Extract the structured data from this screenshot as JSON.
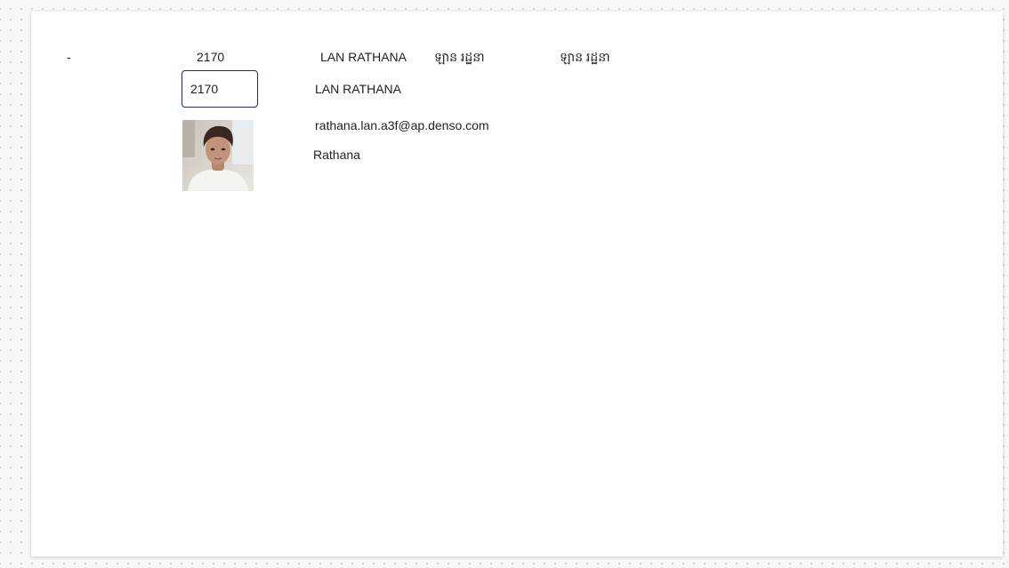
{
  "header_row": {
    "dash": "-",
    "employee_id": "2170",
    "full_name": "LAN RATHANA",
    "khmer_name_1": "ឡាន រដ្ឋនា",
    "khmer_name_2": "ឡាន រដ្ឋនា"
  },
  "form": {
    "employee_id_value": "2170",
    "full_name": "LAN RATHANA",
    "email": "rathana.lan.a3f@ap.denso.com",
    "nickname": "Rathana"
  },
  "photo": {
    "icon": "employee-photo"
  },
  "colors": {
    "input_border": "#1b2a6b",
    "canvas": "#ffffff",
    "background": "#f7f7f7"
  }
}
